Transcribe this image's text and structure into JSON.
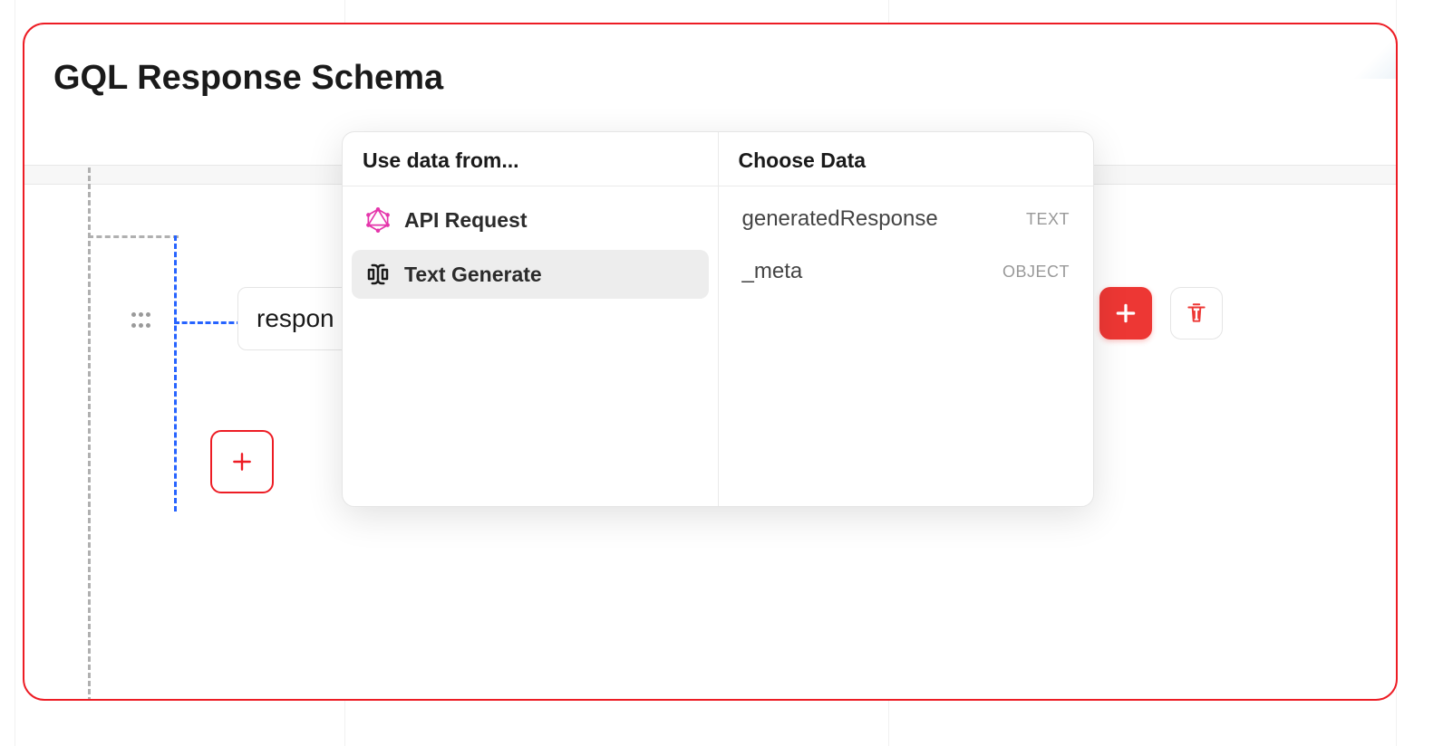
{
  "title": "GQL Response Schema",
  "field": {
    "name": "respon"
  },
  "popup": {
    "left_header": "Use data from...",
    "right_header": "Choose Data",
    "sources": [
      {
        "label": "API Request",
        "icon": "graphql-icon",
        "selected": false
      },
      {
        "label": "Text Generate",
        "icon": "text-cursor-icon",
        "selected": true
      }
    ],
    "data_options": [
      {
        "name": "generatedResponse",
        "type": "TEXT"
      },
      {
        "name": "_meta",
        "type": "OBJECT"
      }
    ]
  }
}
